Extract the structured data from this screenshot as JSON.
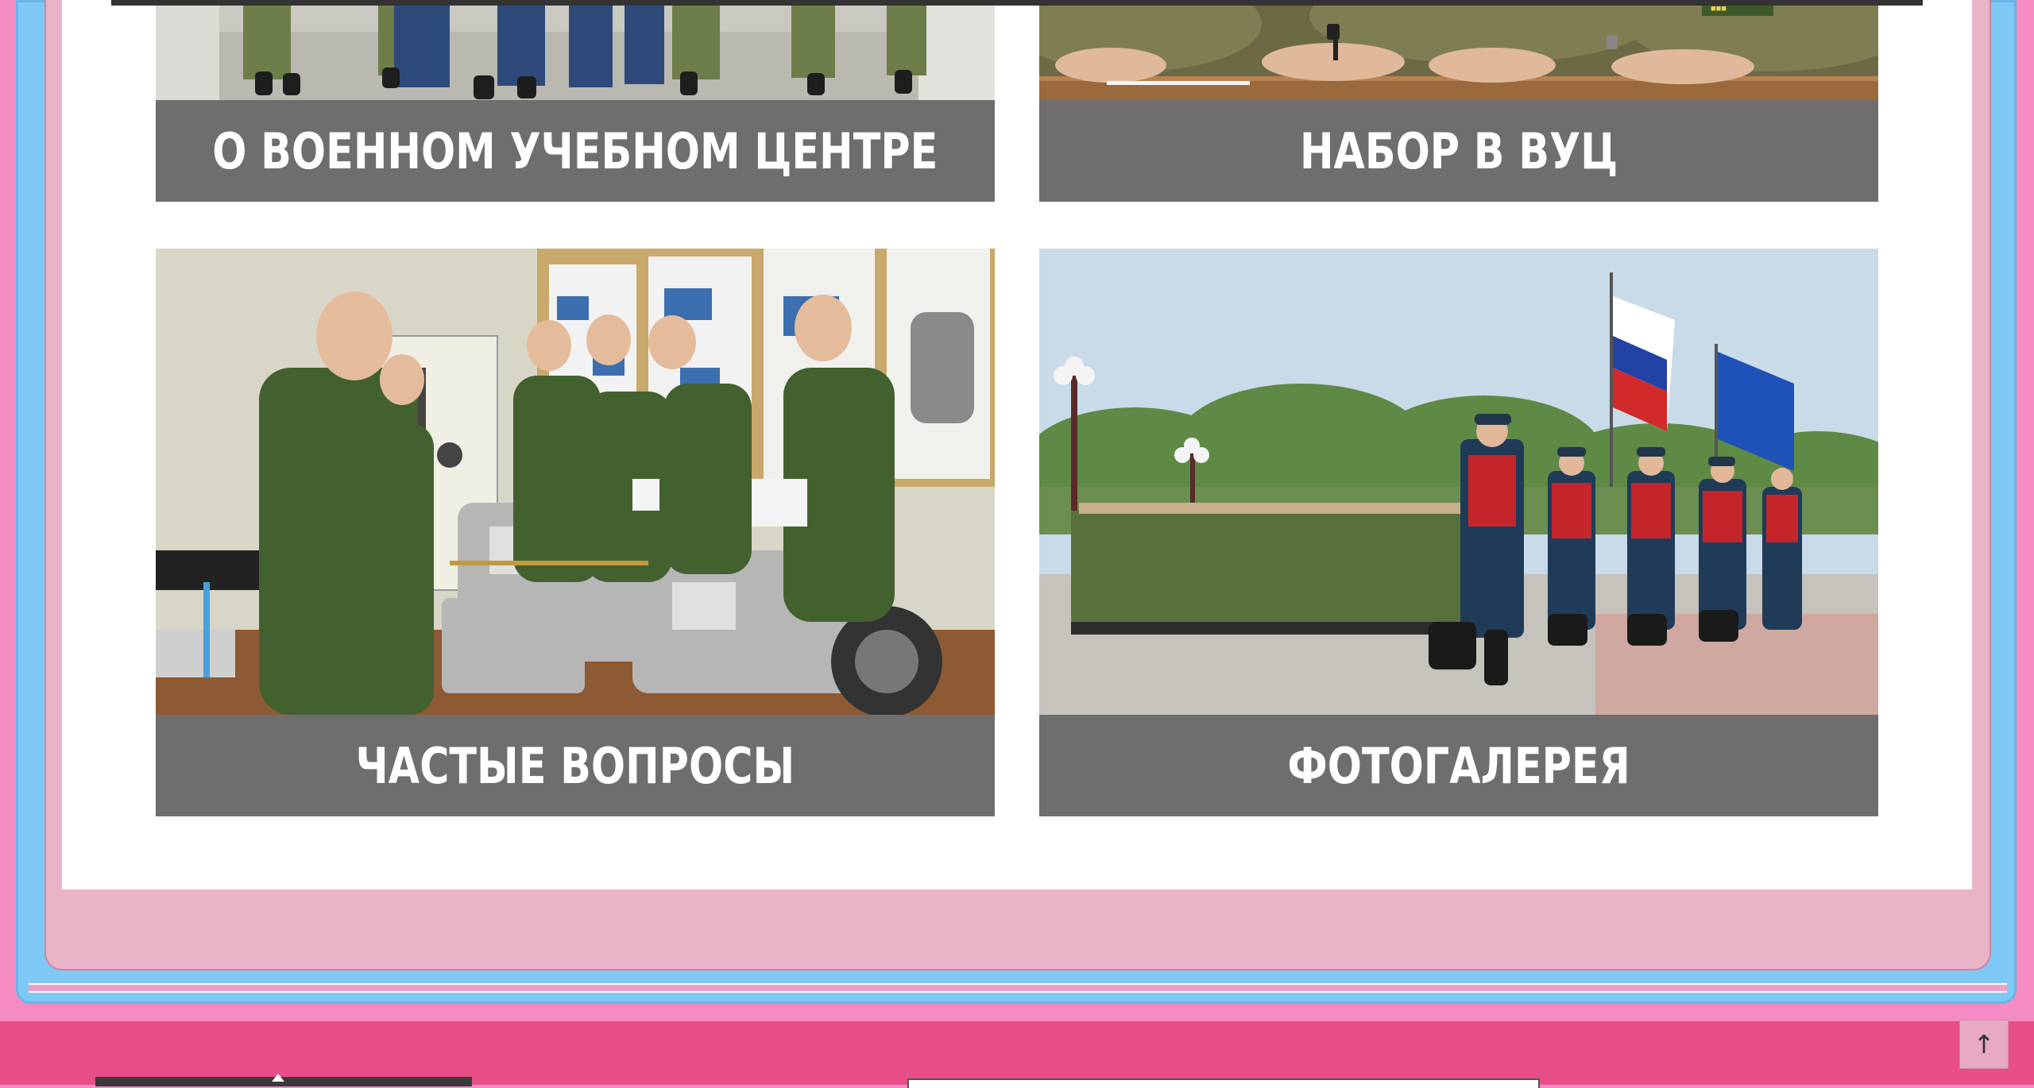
{
  "cards": [
    {
      "id": "about",
      "label": "О ВОЕННОМ УЧЕБНОМ ЦЕНТРЕ"
    },
    {
      "id": "admission",
      "label": "НАБОР В ВУЦ"
    },
    {
      "id": "faq",
      "label": "ЧАСТЫЕ ВОПРОСЫ"
    },
    {
      "id": "gallery",
      "label": "ФОТОГАЛЕРЕЯ"
    }
  ],
  "scroll_top": {
    "label": "↑"
  },
  "colors": {
    "caption_bg": "#6e6e6e",
    "footer_bg": "#e84e86",
    "frame_blue": "#7ec8f6",
    "frame_pink": "#eab4c8",
    "page_bg": "#f48cc3"
  }
}
